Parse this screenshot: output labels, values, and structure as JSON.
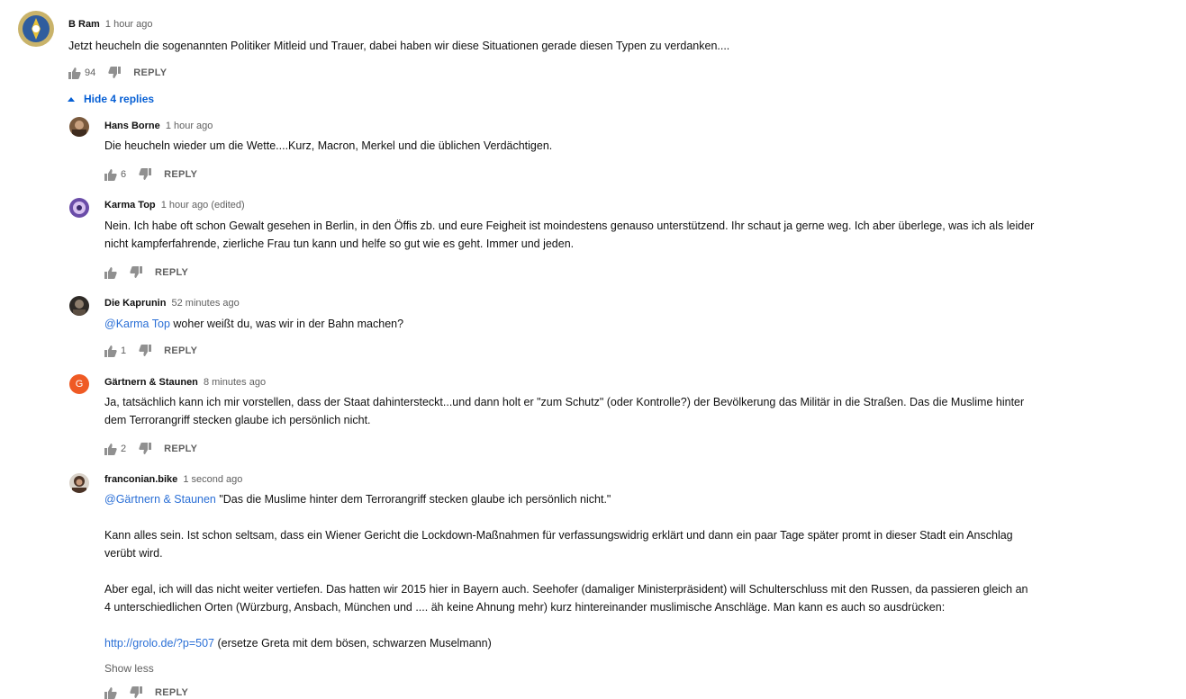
{
  "top_comment": {
    "author": "B Ram",
    "time": "1 hour ago",
    "text": "Jetzt heucheln die sogenannten Politiker Mitleid und Trauer, dabei haben wir diese Situationen gerade diesen Typen zu verdanken....",
    "likes": "94",
    "reply_label": "REPLY"
  },
  "hide_replies_label": "Hide 4 replies",
  "replies": [
    {
      "author": "Hans Borne",
      "time": "1 hour ago",
      "text": "Die heucheln wieder um die Wette....Kurz, Macron, Merkel und die üblichen Verdächtigen.",
      "likes": "6",
      "reply_label": "REPLY"
    },
    {
      "author": "Karma Top",
      "time": "1 hour ago (edited)",
      "text_line1": "Nein. Ich habe oft schon Gewalt gesehen in Berlin, in den Öffis zb. und eure Feigheit ist moindestens genauso unterstützend. Ihr schaut ja gerne weg. Ich aber überlege, was ich als leider",
      "text_line2": "nicht kampferfahrende, zierliche Frau tun kann und helfe so gut wie es geht. Immer und jeden.",
      "likes": "",
      "reply_label": "REPLY"
    },
    {
      "author": "Die Kaprunin",
      "time": "52 minutes ago",
      "mention": "@Karma Top",
      "text": " woher weißt du, was wir in der Bahn machen?",
      "likes": "1",
      "reply_label": "REPLY"
    },
    {
      "author": "Gärtnern & Staunen",
      "time": "8 minutes ago",
      "avatar_letter": "G",
      "text_line1": "Ja, tatsächlich kann ich mir vorstellen, dass der Staat dahintersteckt...und dann holt er \"zum Schutz\" (oder Kontrolle?) der Bevölkerung das Militär in die Straßen. Das die Muslime hinter",
      "text_line2": "dem Terrorangriff stecken glaube ich persönlich nicht.",
      "likes": "2",
      "reply_label": "REPLY"
    },
    {
      "author": "franconian.bike",
      "time": "1 second ago",
      "mention": "@Gärtnern & Staunen",
      "quote": " \"Das die Muslime hinter dem Terrorangriff stecken glaube ich persönlich nicht.\"",
      "para2_line1": "Kann alles sein. Ist schon seltsam, dass ein Wiener Gericht die Lockdown-Maßnahmen für verfassungswidrig erklärt und dann ein paar Tage später promt in dieser Stadt ein Anschlag",
      "para2_line2": "verübt wird.",
      "para3_line1": "Aber egal, ich will das nicht weiter vertiefen. Das hatten wir 2015 hier in Bayern auch. Seehofer (damaliger Ministerpräsident) will Schulterschluss mit den Russen, da passieren gleich an",
      "para3_line2": "4 unterschiedlichen Orten (Würzburg, Ansbach, München und .... äh keine Ahnung mehr) kurz hintereinander muslimische Anschläge. Man kann es auch so ausdrücken:",
      "link": "http://grolo.de/?p=507",
      "link_suffix": " (ersetze Greta mit dem bösen, schwarzen Muselmann)",
      "show_less": "Show less",
      "likes": "",
      "reply_label": "REPLY"
    }
  ],
  "colors": {
    "link": "#2a6fd6",
    "hide_replies": "#065fd4",
    "avatar_g": "#ef5a24",
    "meta": "#606060"
  },
  "icons": [
    "thumb-up-icon",
    "thumb-down-icon",
    "chevron-up-icon"
  ]
}
